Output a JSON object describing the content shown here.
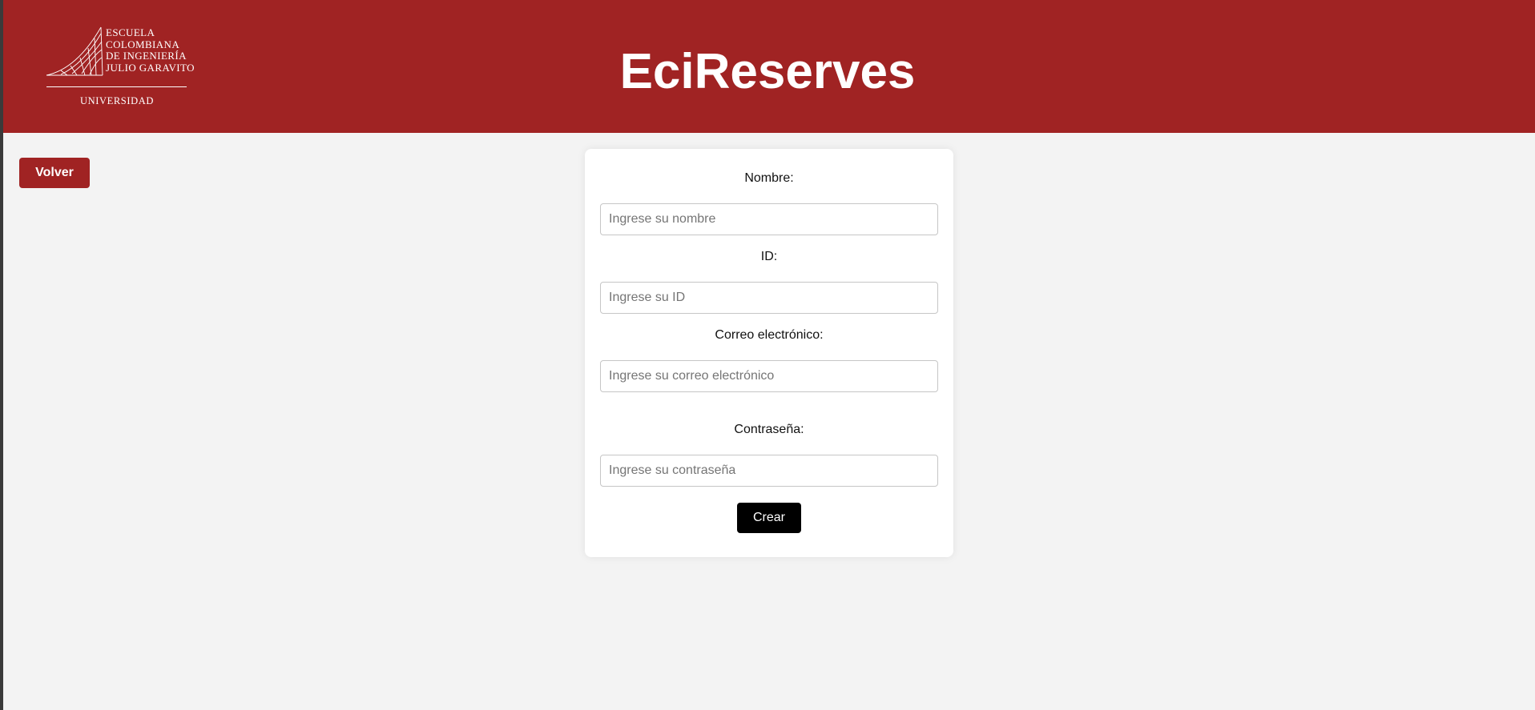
{
  "header": {
    "logo": {
      "lines": [
        "ESCUELA",
        "COLOMBIANA",
        "DE INGENIERÍA",
        "JULIO GARAVITO"
      ],
      "subtitle": "UNIVERSIDAD"
    },
    "title": "EciReserves",
    "background_color": "#a02323"
  },
  "back_button": {
    "label": "Volver"
  },
  "form": {
    "fields": [
      {
        "label": "Nombre:",
        "placeholder": "Ingrese su nombre",
        "value": ""
      },
      {
        "label": "ID:",
        "placeholder": "Ingrese su ID",
        "value": ""
      },
      {
        "label": "Correo electrónico:",
        "placeholder": "Ingrese su correo electrónico",
        "value": ""
      },
      {
        "label": "Contraseña:",
        "placeholder": "Ingrese su contraseña",
        "value": ""
      }
    ],
    "submit_label": "Crear"
  },
  "colors": {
    "accent": "#a02323",
    "page_background": "#f3f3f3",
    "submit_background": "#000000"
  }
}
